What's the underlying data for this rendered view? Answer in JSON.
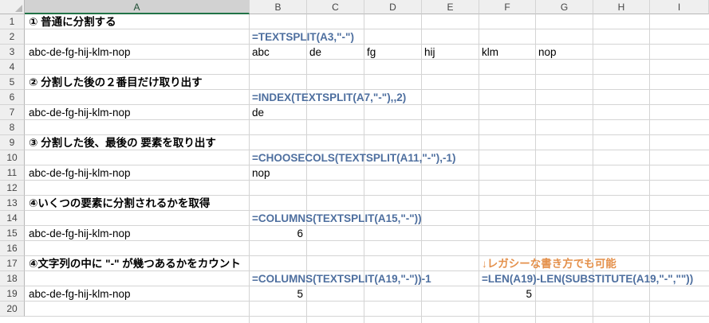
{
  "columns": [
    "A",
    "B",
    "C",
    "D",
    "E",
    "F",
    "G",
    "H",
    "I"
  ],
  "rows": [
    "1",
    "2",
    "3",
    "4",
    "5",
    "6",
    "7",
    "8",
    "9",
    "10",
    "11",
    "12",
    "13",
    "14",
    "15",
    "16",
    "17",
    "18",
    "19",
    "20"
  ],
  "cells": {
    "r1_a": "① 普通に分割する",
    "r2_b": "=TEXTSPLIT(A3,\"-\")",
    "r3_a": "abc-de-fg-hij-klm-nop",
    "r3_b": "abc",
    "r3_c": "de",
    "r3_d": "fg",
    "r3_e": "hij",
    "r3_f": "klm",
    "r3_g": "nop",
    "r5_a": "② 分割した後の２番目だけ取り出す",
    "r6_b": "=INDEX(TEXTSPLIT(A7,\"-\"),,2)",
    "r7_a": "abc-de-fg-hij-klm-nop",
    "r7_b": "de",
    "r9_a": "③ 分割した後、最後の 要素を取り出す",
    "r10_b": "=CHOOSECOLS(TEXTSPLIT(A11,\"-\"),-1)",
    "r11_a": "abc-de-fg-hij-klm-nop",
    "r11_b": "nop",
    "r13_a": "④いくつの要素に分割されるかを取得",
    "r14_b": "=COLUMNS(TEXTSPLIT(A15,\"-\"))",
    "r15_a": "abc-de-fg-hij-klm-nop",
    "r15_b": "6",
    "r17_a": "④文字列の中に \"-\" が幾つあるかをカウント",
    "r17_f": "↓レガシーな書き方でも可能",
    "r18_b": "=COLUMNS(TEXTSPLIT(A19,\"-\"))-1",
    "r18_f": "=LEN(A19)-LEN(SUBSTITUTE(A19,\"-\",\"\"))",
    "r19_a": "abc-de-fg-hij-klm-nop",
    "r19_b": "5",
    "r19_f": "5"
  },
  "colors": {
    "formula_text": "#4e6f9f",
    "note_text": "#e4904b",
    "selected_column_accent": "#217346",
    "gridline": "#d4d4d4"
  }
}
